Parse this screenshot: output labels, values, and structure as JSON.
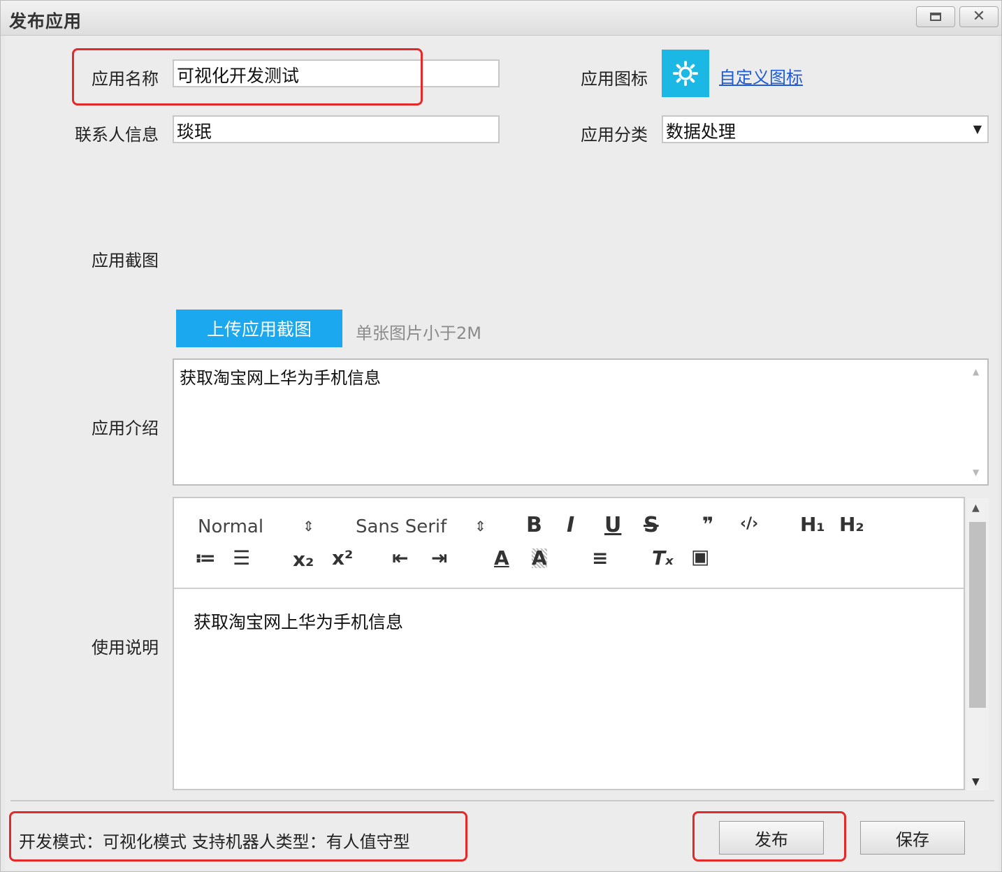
{
  "window": {
    "title": "发布应用",
    "restore_icon": "restore-icon",
    "close_label": "✕"
  },
  "form": {
    "app_name_label": "应用名称",
    "app_name_value": "可视化开发测试",
    "contact_label": "联系人信息",
    "contact_value": "琰珉",
    "icon_label": "应用图标",
    "icon_name": "gear-icon",
    "custom_icon_link": "自定义图标",
    "category_label": "应用分类",
    "category_value": "数据处理",
    "screenshot_label": "应用截图",
    "upload_button": "上传应用截图",
    "upload_hint": "单张图片小于2M",
    "intro_label": "应用介绍",
    "intro_value": "获取淘宝网上华为手机信息",
    "usage_label": "使用说明",
    "usage_value": "获取淘宝网上华为手机信息"
  },
  "editor_toolbar": {
    "size_select": "Normal",
    "font_select": "Sans Serif",
    "select_arrows": "⇕",
    "bold": "B",
    "italic": "I",
    "underline": "U",
    "strike": "S",
    "quote": "❞",
    "code": "‹/›",
    "h1": "H₁",
    "h2": "H₂",
    "ordered_list": "≔",
    "bullet_list": "☰",
    "subscript": "x₂",
    "superscript": "x²",
    "outdent": "⇤",
    "indent": "⇥",
    "text_color": "A",
    "background_color": "A",
    "align": "≡",
    "clean": "Tₓ",
    "image": "▣"
  },
  "footer": {
    "info": "开发模式：可视化模式    支持机器人类型：有人值守型",
    "publish_button": "发布",
    "save_button": "保存"
  },
  "colors": {
    "accent": "#1ba8ee",
    "icon_tile": "#1bb8e6",
    "highlight_box": "#e22a2a",
    "link": "#1e5bd8"
  }
}
